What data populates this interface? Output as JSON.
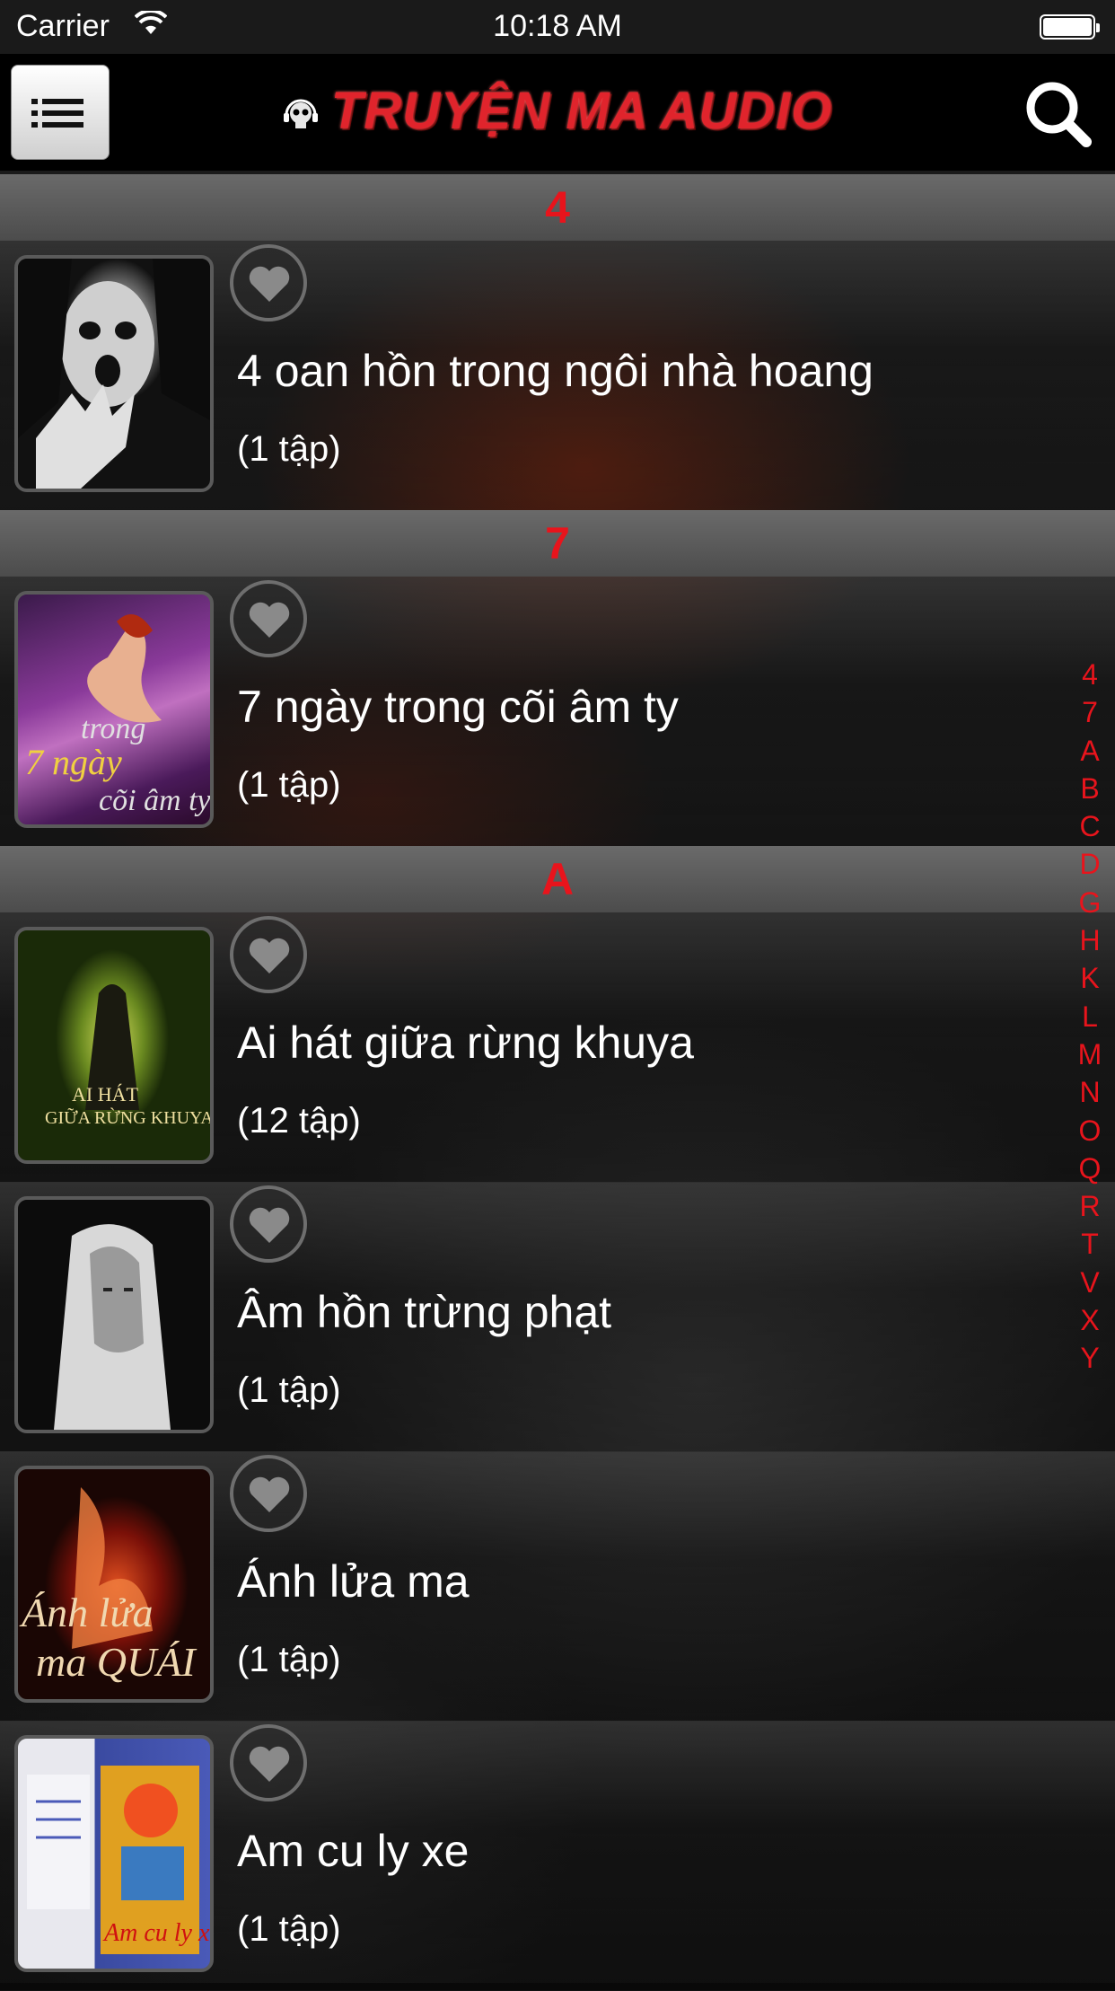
{
  "status_bar": {
    "carrier": "Carrier",
    "time": "10:18 AM"
  },
  "header": {
    "title": "TRUYỆN MA AUDIO"
  },
  "sections": [
    {
      "header": "4",
      "items": [
        {
          "title": "4 oan hồn trong ngôi nhà hoang",
          "count": "(1 tập)"
        }
      ]
    },
    {
      "header": "7",
      "items": [
        {
          "title": "7 ngày trong cõi âm ty",
          "count": "(1 tập)"
        }
      ]
    },
    {
      "header": "A",
      "items": [
        {
          "title": "Ai hát giữa rừng khuya",
          "count": "(12 tập)"
        },
        {
          "title": "Âm hồn trừng phạt",
          "count": "(1 tập)"
        },
        {
          "title": "Ánh lửa ma",
          "count": "(1 tập)"
        },
        {
          "title": "Am cu ly xe",
          "count": "(1 tập)"
        }
      ]
    }
  ],
  "index_letters": [
    "4",
    "7",
    "A",
    "B",
    "C",
    "D",
    "G",
    "H",
    "K",
    "L",
    "M",
    "N",
    "O",
    "Q",
    "R",
    "T",
    "V",
    "X",
    "Y"
  ],
  "colors": {
    "accent": "#e8141c",
    "header_bg": "#000000",
    "section_bg": "#5a5a5a"
  }
}
